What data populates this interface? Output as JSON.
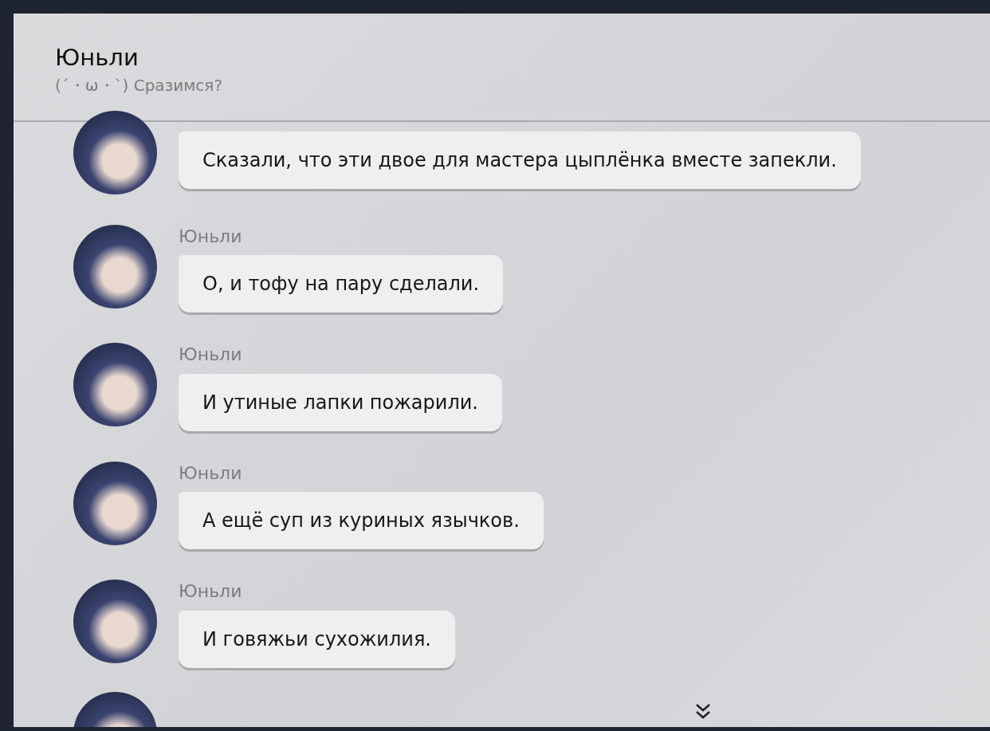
{
  "header": {
    "title": "Юньли",
    "subtitle": "(´・ω・`) Сразимся?"
  },
  "messages": [
    {
      "kind": "message",
      "text": "Сказали, что эти двое для мастера цыплёнка вместе запекли."
    },
    {
      "kind": "message",
      "name": "Юньли",
      "text": "О, и тофу на пару сделали."
    },
    {
      "kind": "message",
      "name": "Юньли",
      "text": "И утиные лапки пожарили."
    },
    {
      "kind": "message",
      "name": "Юньли",
      "text": "А ещё суп из куриных язычков."
    },
    {
      "kind": "message",
      "name": "Юньли",
      "text": "И говяжьи сухожилия."
    },
    {
      "kind": "partial"
    }
  ]
}
